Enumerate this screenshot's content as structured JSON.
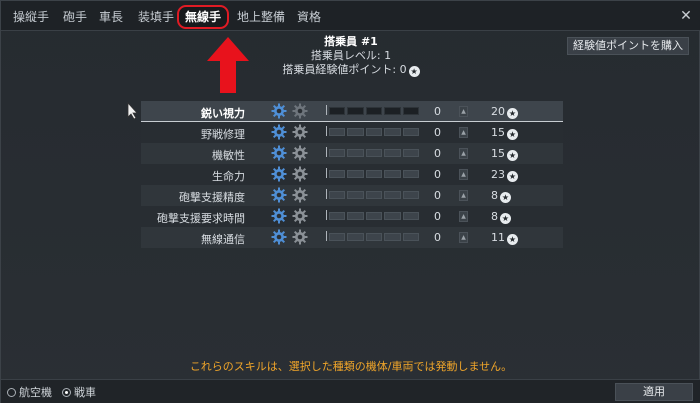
{
  "tabs": [
    {
      "label": "操縦手",
      "active": false
    },
    {
      "label": "砲手",
      "active": false
    },
    {
      "label": "車長",
      "active": false
    },
    {
      "label": "装填手",
      "active": false
    },
    {
      "label": "無線手",
      "active": true
    },
    {
      "label": "地上整備",
      "active": false
    },
    {
      "label": "資格",
      "active": false
    }
  ],
  "close_label": "✕",
  "buy_button_label": "経験値ポイントを購入",
  "crew": {
    "name": "搭乗員 #1",
    "level_line": "搭乗員レベル: 1",
    "points_line": "搭乗員経験値ポイント: 0"
  },
  "skills": [
    {
      "name": "鋭い視力",
      "level": "0",
      "cost": "20",
      "selected": true
    },
    {
      "name": "野戦修理",
      "level": "0",
      "cost": "15",
      "selected": false
    },
    {
      "name": "機敏性",
      "level": "0",
      "cost": "15",
      "selected": false
    },
    {
      "name": "生命力",
      "level": "0",
      "cost": "23",
      "selected": false
    },
    {
      "name": "砲撃支援精度",
      "level": "0",
      "cost": "8",
      "selected": false
    },
    {
      "name": "砲撃支援要求時間",
      "level": "0",
      "cost": "8",
      "selected": false
    },
    {
      "name": "無線通信",
      "level": "0",
      "cost": "11",
      "selected": false
    }
  ],
  "notice": "これらのスキルは、選択した種類の機体/車両では発動しません。",
  "vehicle_type": {
    "options": [
      {
        "label": "航空機",
        "selected": false
      },
      {
        "label": "戦車",
        "selected": true
      }
    ]
  },
  "apply_label": "適用",
  "colors": {
    "accent_red": "#e01b24",
    "notice_orange": "#f0a52a"
  },
  "icons": {
    "gear_primary": "blue-gear-icon",
    "gear_secondary": "gray-gear-icon",
    "star": "star-coin-icon",
    "arrow": "red-up-arrow-icon"
  }
}
